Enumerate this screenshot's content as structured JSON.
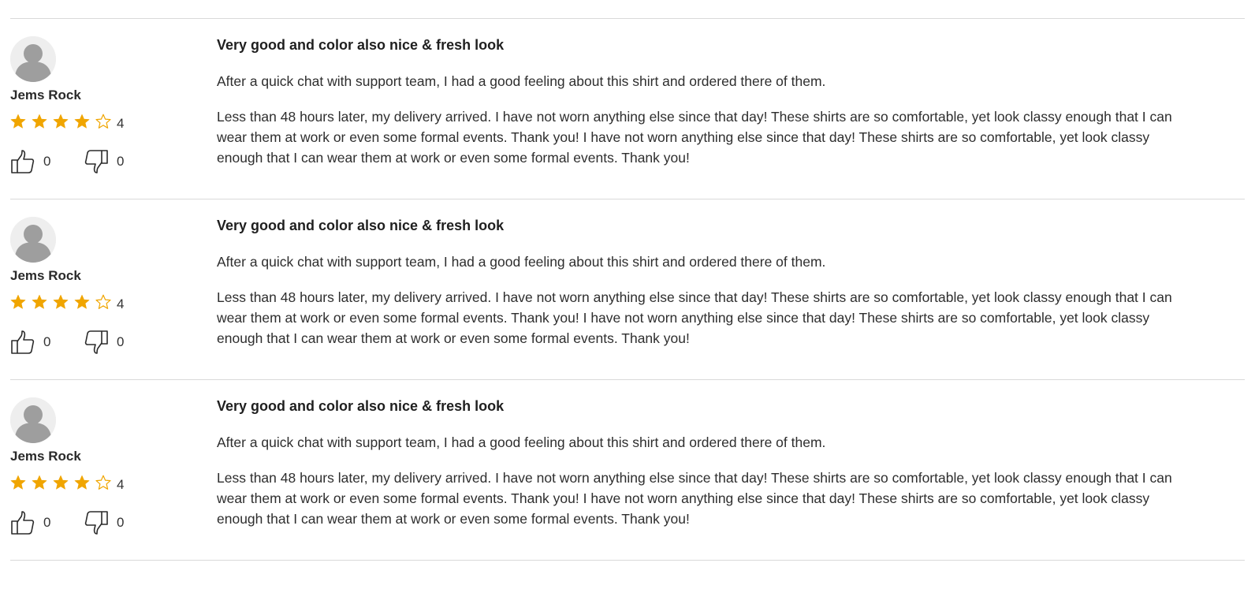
{
  "colors": {
    "star_filled": "#f0a500",
    "star_empty": "#f0a500",
    "divider": "#d9d9d9",
    "avatar_silhouette": "#9e9e9e"
  },
  "reviews": [
    {
      "reviewer": "Jems Rock",
      "rating": 4,
      "rating_max": 5,
      "rating_label": "4",
      "likes": "0",
      "dislikes": "0",
      "title": "Very good and color also nice & fresh look",
      "paragraph_1": "After a quick chat with support team, I had a good feeling about this shirt and ordered there of them.",
      "paragraph_2": "Less than 48 hours later, my delivery arrived. I have not worn anything else since that day! These shirts are so comfortable, yet look classy enough that I can wear them at work or even some formal events. Thank you! I have not worn anything else since that day! These shirts are so comfortable, yet look classy enough that I can wear them at work or even some formal events. Thank you!"
    },
    {
      "reviewer": "Jems Rock",
      "rating": 4,
      "rating_max": 5,
      "rating_label": "4",
      "likes": "0",
      "dislikes": "0",
      "title": "Very good and color also nice & fresh look",
      "paragraph_1": "After a quick chat with support team, I had a good feeling about this shirt and ordered there of them.",
      "paragraph_2": "Less than 48 hours later, my delivery arrived. I have not worn anything else since that day! These shirts are so comfortable, yet look classy enough that I can wear them at work or even some formal events. Thank you! I have not worn anything else since that day! These shirts are so comfortable, yet look classy enough that I can wear them at work or even some formal events. Thank you!"
    },
    {
      "reviewer": "Jems Rock",
      "rating": 4,
      "rating_max": 5,
      "rating_label": "4",
      "likes": "0",
      "dislikes": "0",
      "title": "Very good and color also nice & fresh look",
      "paragraph_1": "After a quick chat with support team, I had a good feeling about this shirt and ordered there of them.",
      "paragraph_2": "Less than 48 hours later, my delivery arrived. I have not worn anything else since that day! These shirts are so comfortable, yet look classy enough that I can wear them at work or even some formal events. Thank you! I have not worn anything else since that day! These shirts are so comfortable, yet look classy enough that I can wear them at work or even some formal events. Thank you!"
    }
  ]
}
